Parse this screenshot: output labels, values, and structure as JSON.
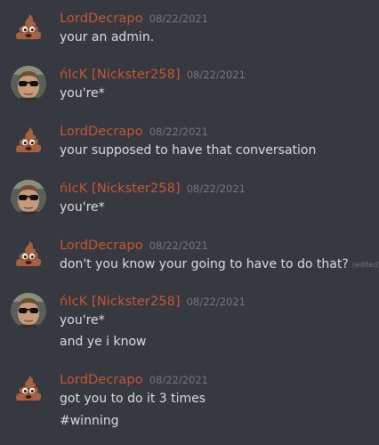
{
  "users": {
    "lord": "LordDecrapo",
    "nick": "ńΙcΚ [Nickster258]"
  },
  "messages": [
    {
      "author": "LordDecrapo",
      "timestamp": "08/22/2021",
      "lines": [
        "your an admin."
      ],
      "avatar": "poop-emoji-avatar"
    },
    {
      "author": "ńΙcΚ [Nickster258]",
      "timestamp": "08/22/2021",
      "lines": [
        "you're*"
      ],
      "avatar": "sunglasses-man-avatar"
    },
    {
      "author": "LordDecrapo",
      "timestamp": "08/22/2021",
      "lines": [
        "your supposed to have that conversation"
      ],
      "avatar": "poop-emoji-avatar"
    },
    {
      "author": "ńΙcΚ [Nickster258]",
      "timestamp": "08/22/2021",
      "lines": [
        "you're*"
      ],
      "avatar": "sunglasses-man-avatar"
    },
    {
      "author": "LordDecrapo",
      "timestamp": "08/22/2021",
      "lines": [
        "don't you know your going to have to do that?"
      ],
      "edited": "(edited)",
      "avatar": "poop-emoji-avatar"
    },
    {
      "author": "ńΙcΚ [Nickster258]",
      "timestamp": "08/22/2021",
      "lines": [
        "you're*",
        "and ye i know"
      ],
      "avatar": "sunglasses-man-avatar"
    },
    {
      "author": "LordDecrapo",
      "timestamp": "08/22/2021",
      "lines": [
        "got you to do it 3 times",
        "#winning"
      ],
      "avatar": "poop-emoji-avatar"
    }
  ],
  "colors": {
    "background": "#36393f",
    "username": "#c9572e",
    "timestamp": "#72767d",
    "text": "#dcddde"
  }
}
